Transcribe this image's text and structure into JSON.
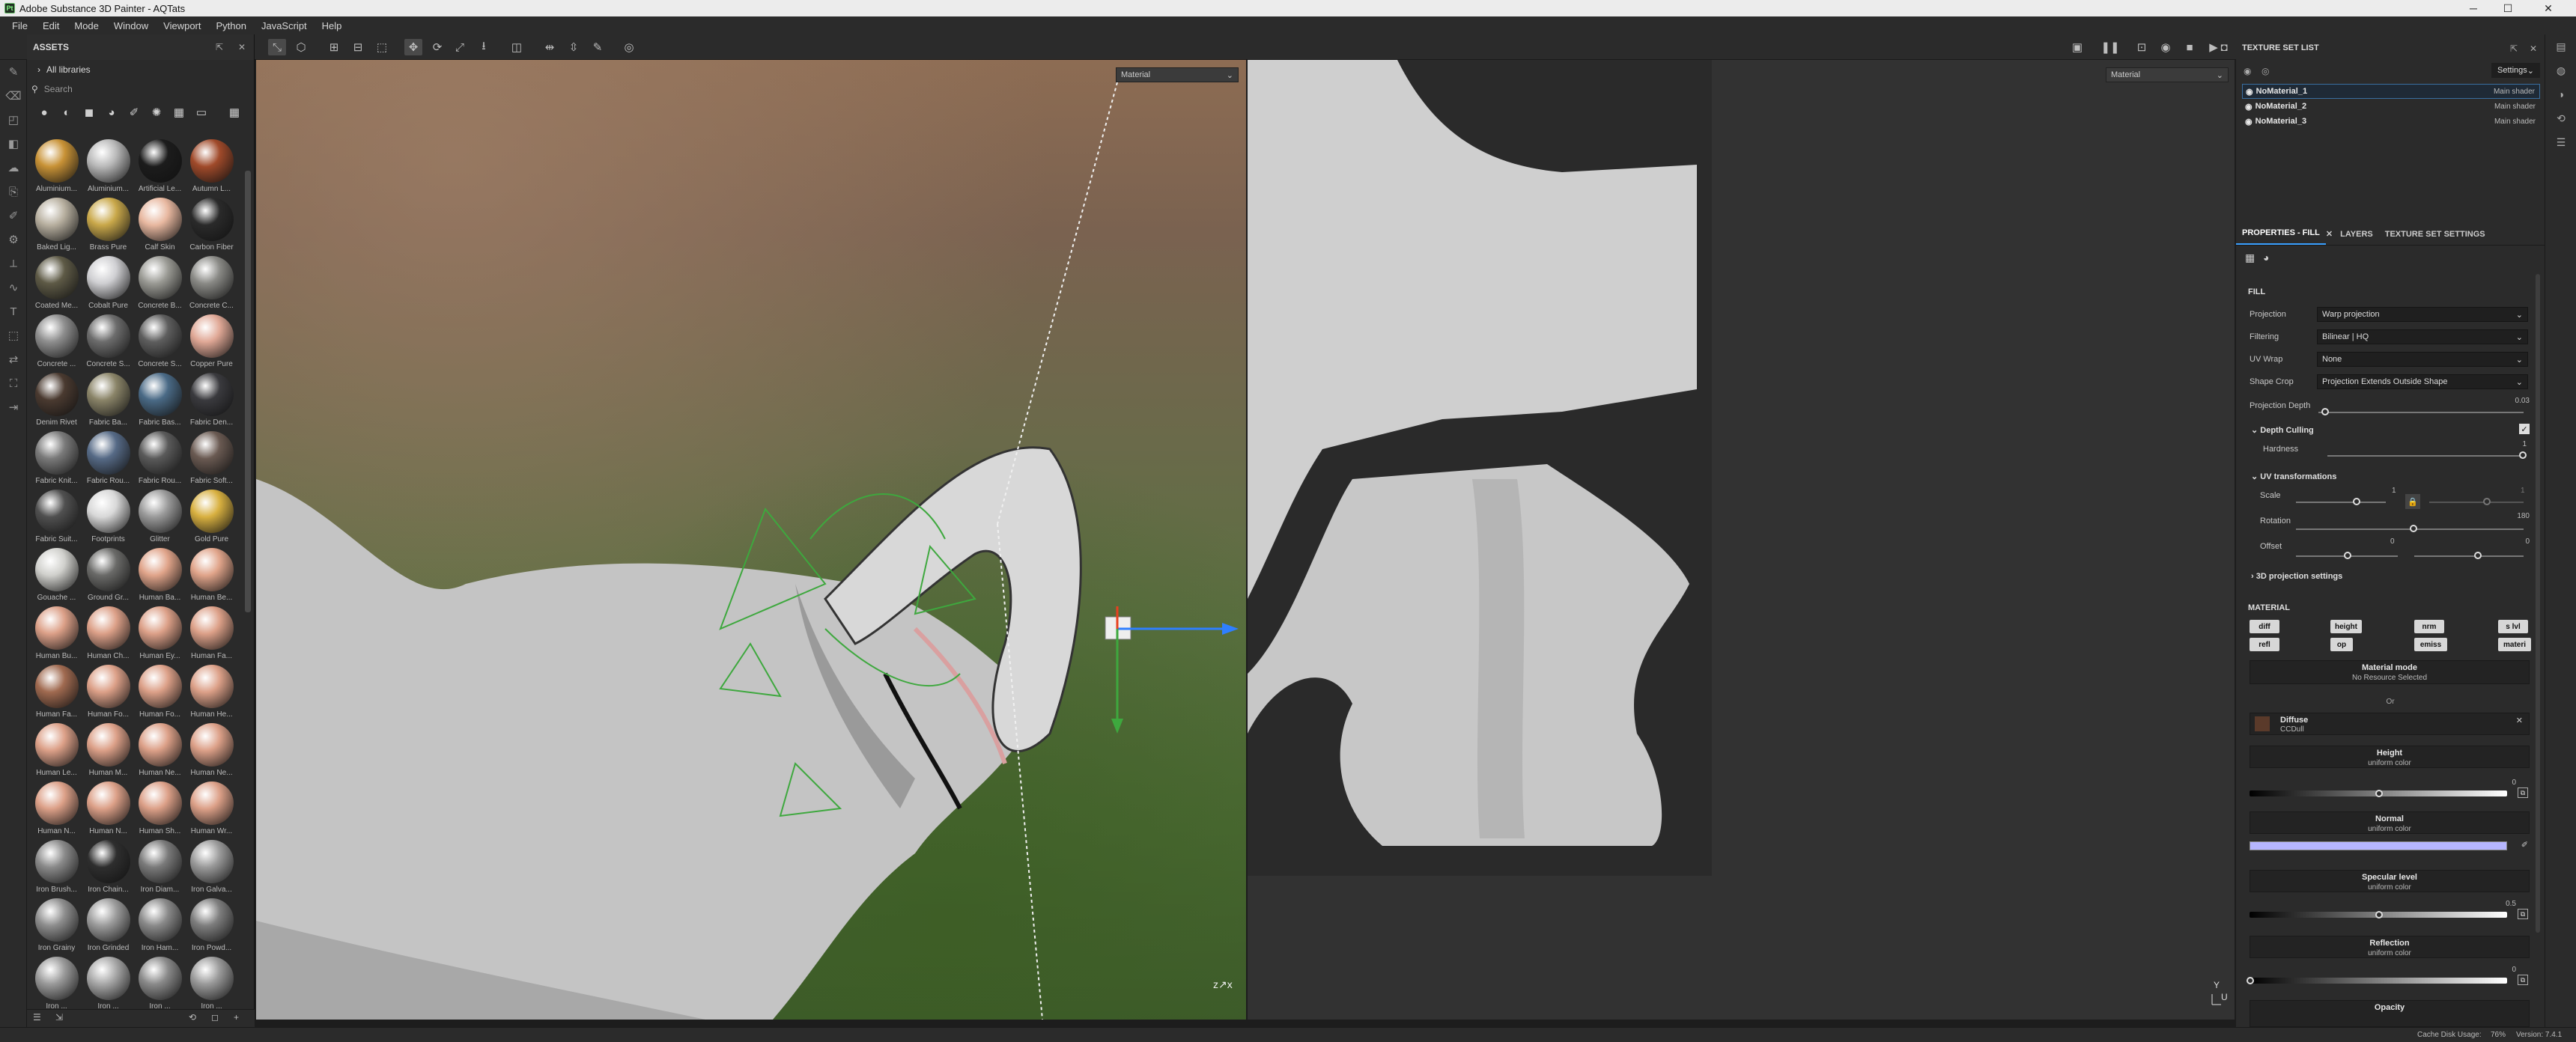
{
  "window": {
    "title": "Adobe Substance 3D Painter - AQTats",
    "minimize": "─",
    "maximize": "☐",
    "close": "✕"
  },
  "menu": [
    "File",
    "Edit",
    "Mode",
    "Window",
    "Viewport",
    "Python",
    "JavaScript",
    "Help"
  ],
  "assets": {
    "title": "ASSETS",
    "library": "All libraries",
    "search_placeholder": "Search",
    "items": [
      {
        "label": "Aluminium...",
        "color": "#c89236"
      },
      {
        "label": "Aluminium...",
        "color": "#b9b9b9"
      },
      {
        "label": "Artificial Le...",
        "color": "#1c1c1c"
      },
      {
        "label": "Autumn L...",
        "color": "#a04a2a"
      },
      {
        "label": "Baked Lig...",
        "color": "#b8b0a0"
      },
      {
        "label": "Brass Pure",
        "color": "#c9a84a"
      },
      {
        "label": "Calf Skin",
        "color": "#e8b8a0"
      },
      {
        "label": "Carbon Fiber",
        "color": "#2a2a2a"
      },
      {
        "label": "Coated Me...",
        "color": "#5e5a46"
      },
      {
        "label": "Cobalt Pure",
        "color": "#cfcfd2"
      },
      {
        "label": "Concrete B...",
        "color": "#9a9a94"
      },
      {
        "label": "Concrete C...",
        "color": "#8a8a86"
      },
      {
        "label": "Concrete ...",
        "color": "#8e8e8e"
      },
      {
        "label": "Concrete S...",
        "color": "#6c6c6c"
      },
      {
        "label": "Concrete S...",
        "color": "#5e5e5e"
      },
      {
        "label": "Copper Pure",
        "color": "#e0a896"
      },
      {
        "label": "Denim Rivet",
        "color": "#4a3a30"
      },
      {
        "label": "Fabric Ba...",
        "color": "#8a8468"
      },
      {
        "label": "Fabric Bas...",
        "color": "#4a6a86"
      },
      {
        "label": "Fabric Den...",
        "color": "#3a3a3e"
      },
      {
        "label": "Fabric Knit...",
        "color": "#7a7a7a"
      },
      {
        "label": "Fabric Rou...",
        "color": "#566a86"
      },
      {
        "label": "Fabric Rou...",
        "color": "#5a5a5a"
      },
      {
        "label": "Fabric Soft...",
        "color": "#6a5a52"
      },
      {
        "label": "Fabric Suit...",
        "color": "#505050"
      },
      {
        "label": "Footprints",
        "color": "#d8d8d8"
      },
      {
        "label": "Glitter",
        "color": "#9a9a9a"
      },
      {
        "label": "Gold Pure",
        "color": "#d8b040"
      },
      {
        "label": "Gouache ...",
        "color": "#d0d0cc"
      },
      {
        "label": "Ground Gr...",
        "color": "#6a6a68"
      },
      {
        "label": "Human Ba...",
        "color": "#e0a48a"
      },
      {
        "label": "Human Be...",
        "color": "#e0a48a"
      },
      {
        "label": "Human Bu...",
        "color": "#dca088"
      },
      {
        "label": "Human Ch...",
        "color": "#dca088"
      },
      {
        "label": "Human Ey...",
        "color": "#dca088"
      },
      {
        "label": "Human Fa...",
        "color": "#dca088"
      },
      {
        "label": "Human Fa...",
        "color": "#a06a50"
      },
      {
        "label": "Human Fo...",
        "color": "#dca088"
      },
      {
        "label": "Human Fo...",
        "color": "#dca088"
      },
      {
        "label": "Human He...",
        "color": "#dca088"
      },
      {
        "label": "Human Le...",
        "color": "#dca088"
      },
      {
        "label": "Human M...",
        "color": "#dca088"
      },
      {
        "label": "Human Ne...",
        "color": "#dca088"
      },
      {
        "label": "Human Ne...",
        "color": "#dca088"
      },
      {
        "label": "Human N...",
        "color": "#dca088"
      },
      {
        "label": "Human N...",
        "color": "#dca088"
      },
      {
        "label": "Human Sh...",
        "color": "#dca088"
      },
      {
        "label": "Human Wr...",
        "color": "#dca088"
      },
      {
        "label": "Iron Brush...",
        "color": "#8a8a8a"
      },
      {
        "label": "Iron Chain...",
        "color": "#2e2e2e"
      },
      {
        "label": "Iron Diam...",
        "color": "#7a7a7a"
      },
      {
        "label": "Iron Galva...",
        "color": "#9a9a9a"
      },
      {
        "label": "Iron Grainy",
        "color": "#8e8e8e"
      },
      {
        "label": "Iron Grinded",
        "color": "#9c9c9c"
      },
      {
        "label": "Iron Ham...",
        "color": "#8a8a8a"
      },
      {
        "label": "Iron Powd...",
        "color": "#7e7e7e"
      },
      {
        "label": "Iron ...",
        "color": "#9a9a9a"
      },
      {
        "label": "Iron ...",
        "color": "#a8a8a8"
      },
      {
        "label": "Iron ...",
        "color": "#8a8a8a"
      },
      {
        "label": "Iron ...",
        "color": "#9a9a9a"
      }
    ]
  },
  "viewport": {
    "material_3d": "Material",
    "material_2d": "Material"
  },
  "texture_set_list": {
    "title": "TEXTURE SET LIST",
    "settings": "Settings",
    "items": [
      {
        "name": "NoMaterial_1",
        "shader": "Main shader"
      },
      {
        "name": "NoMaterial_2",
        "shader": "Main shader"
      },
      {
        "name": "NoMaterial_3",
        "shader": "Main shader"
      }
    ]
  },
  "tabs": {
    "properties": "PROPERTIES - FILL",
    "layers": "LAYERS",
    "texture_set_settings": "TEXTURE SET SETTINGS"
  },
  "fill": {
    "section": "FILL",
    "projection_label": "Projection",
    "projection": "Warp projection",
    "filtering_label": "Filtering",
    "filtering": "Bilinear | HQ",
    "uvwrap_label": "UV Wrap",
    "uvwrap": "None",
    "shapecrop_label": "Shape Crop",
    "shapecrop": "Projection Extends Outside Shape",
    "depth_label": "Projection Depth",
    "depth_value": "0.03",
    "depth_culling": "Depth Culling",
    "hardness_label": "Hardness",
    "hardness_value": "1",
    "uv_transform": "UV transformations",
    "scale_label": "Scale",
    "scale_value": "1",
    "scale_value2": "1",
    "rotation_label": "Rotation",
    "rotation_value": "180",
    "offset_label": "Offset",
    "offset_value": "0",
    "offset_value2": "0",
    "proj3d": "3D projection settings"
  },
  "material": {
    "section": "MATERIAL",
    "channels_row1": [
      "diff",
      "height",
      "nrm",
      "s lvl"
    ],
    "channels_row2": [
      "refl",
      "op",
      "emiss",
      "materi"
    ],
    "mode_title": "Material mode",
    "mode_sub": "No Resource Selected",
    "or": "Or",
    "diffuse_title": "Diffuse",
    "diffuse_sub": "CCDull",
    "height_title": "Height",
    "height_sub": "uniform color",
    "height_value": "0",
    "normal_title": "Normal",
    "normal_sub": "uniform color",
    "normal_color": "#b6b6ff",
    "spec_title": "Specular level",
    "spec_sub": "uniform color",
    "spec_value": "0.5",
    "refl_title": "Reflection",
    "refl_sub": "uniform color",
    "refl_value": "0",
    "opacity_title": "Opacity"
  },
  "status": {
    "cache": "Cache Disk Usage:",
    "cache_value": "76%",
    "version": "Version: 7.4.1"
  }
}
